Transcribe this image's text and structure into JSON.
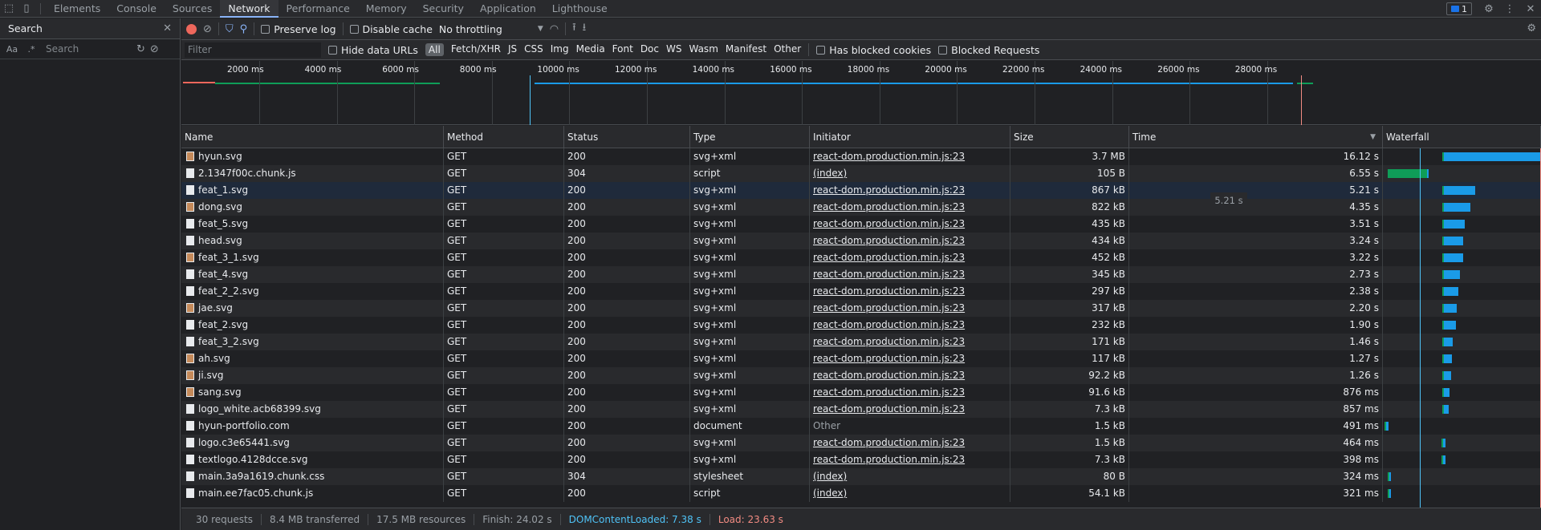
{
  "topbar": {
    "tabs": [
      "Elements",
      "Console",
      "Sources",
      "Network",
      "Performance",
      "Memory",
      "Security",
      "Application",
      "Lighthouse"
    ],
    "active_tab": "Network",
    "issues_count": "1"
  },
  "search_panel": {
    "title": "Search",
    "case_toggle": "Aa",
    "regex_toggle": ".*",
    "placeholder": "Search"
  },
  "toolbar": {
    "preserve_log": "Preserve log",
    "disable_cache": "Disable cache",
    "throttling": "No throttling"
  },
  "filter_bar": {
    "placeholder": "Filter",
    "hide_data_urls": "Hide data URLs",
    "types": [
      "All",
      "Fetch/XHR",
      "JS",
      "CSS",
      "Img",
      "Media",
      "Font",
      "Doc",
      "WS",
      "Wasm",
      "Manifest",
      "Other"
    ],
    "has_blocked_cookies": "Has blocked cookies",
    "blocked_requests": "Blocked Requests"
  },
  "overview": {
    "ticks": [
      "2000 ms",
      "4000 ms",
      "6000 ms",
      "8000 ms",
      "10000 ms",
      "12000 ms",
      "14000 ms",
      "16000 ms",
      "18000 ms",
      "20000 ms",
      "22000 ms",
      "24000 ms",
      "26000 ms",
      "28000 ms"
    ]
  },
  "columns": [
    "Name",
    "Method",
    "Status",
    "Type",
    "Initiator",
    "Size",
    "Time",
    "Waterfall"
  ],
  "rows": [
    {
      "name": "hyun.svg",
      "method": "GET",
      "status": "200",
      "type": "svg+xml",
      "initiator": "react-dom.production.min.js:23",
      "size": "3.7 MB",
      "time": "16.12 s",
      "icon": "img",
      "wf_start": 0.376,
      "wf_wait": 0.01,
      "wf_dl": 0.626
    },
    {
      "name": "2.1347f00c.chunk.js",
      "method": "GET",
      "status": "304",
      "type": "script",
      "initiator": "(index)",
      "size": "105 B",
      "time": "6.55 s",
      "icon": "doc",
      "wf_start": 0.03,
      "wf_wait": 0.25,
      "wf_dl": 0.01
    },
    {
      "name": "feat_1.svg",
      "method": "GET",
      "status": "200",
      "type": "svg+xml",
      "initiator": "react-dom.production.min.js:23",
      "size": "867 kB",
      "time": "5.21 s",
      "icon": "doc",
      "wf_start": 0.376,
      "wf_wait": 0.01,
      "wf_dl": 0.2
    },
    {
      "name": "dong.svg",
      "method": "GET",
      "status": "200",
      "type": "svg+xml",
      "initiator": "react-dom.production.min.js:23",
      "size": "822 kB",
      "time": "4.35 s",
      "icon": "img",
      "wf_start": 0.376,
      "wf_wait": 0.01,
      "wf_dl": 0.165
    },
    {
      "name": "feat_5.svg",
      "method": "GET",
      "status": "200",
      "type": "svg+xml",
      "initiator": "react-dom.production.min.js:23",
      "size": "435 kB",
      "time": "3.51 s",
      "icon": "doc",
      "wf_start": 0.376,
      "wf_wait": 0.01,
      "wf_dl": 0.13
    },
    {
      "name": "head.svg",
      "method": "GET",
      "status": "200",
      "type": "svg+xml",
      "initiator": "react-dom.production.min.js:23",
      "size": "434 kB",
      "time": "3.24 s",
      "icon": "doc",
      "wf_start": 0.376,
      "wf_wait": 0.01,
      "wf_dl": 0.12
    },
    {
      "name": "feat_3_1.svg",
      "method": "GET",
      "status": "200",
      "type": "svg+xml",
      "initiator": "react-dom.production.min.js:23",
      "size": "452 kB",
      "time": "3.22 s",
      "icon": "img",
      "wf_start": 0.376,
      "wf_wait": 0.01,
      "wf_dl": 0.12
    },
    {
      "name": "feat_4.svg",
      "method": "GET",
      "status": "200",
      "type": "svg+xml",
      "initiator": "react-dom.production.min.js:23",
      "size": "345 kB",
      "time": "2.73 s",
      "icon": "doc",
      "wf_start": 0.376,
      "wf_wait": 0.01,
      "wf_dl": 0.1
    },
    {
      "name": "feat_2_2.svg",
      "method": "GET",
      "status": "200",
      "type": "svg+xml",
      "initiator": "react-dom.production.min.js:23",
      "size": "297 kB",
      "time": "2.38 s",
      "icon": "doc",
      "wf_start": 0.376,
      "wf_wait": 0.01,
      "wf_dl": 0.09
    },
    {
      "name": "jae.svg",
      "method": "GET",
      "status": "200",
      "type": "svg+xml",
      "initiator": "react-dom.production.min.js:23",
      "size": "317 kB",
      "time": "2.20 s",
      "icon": "img",
      "wf_start": 0.376,
      "wf_wait": 0.01,
      "wf_dl": 0.08
    },
    {
      "name": "feat_2.svg",
      "method": "GET",
      "status": "200",
      "type": "svg+xml",
      "initiator": "react-dom.production.min.js:23",
      "size": "232 kB",
      "time": "1.90 s",
      "icon": "doc",
      "wf_start": 0.376,
      "wf_wait": 0.01,
      "wf_dl": 0.075
    },
    {
      "name": "feat_3_2.svg",
      "method": "GET",
      "status": "200",
      "type": "svg+xml",
      "initiator": "react-dom.production.min.js:23",
      "size": "171 kB",
      "time": "1.46 s",
      "icon": "doc",
      "wf_start": 0.376,
      "wf_wait": 0.01,
      "wf_dl": 0.055
    },
    {
      "name": "ah.svg",
      "method": "GET",
      "status": "200",
      "type": "svg+xml",
      "initiator": "react-dom.production.min.js:23",
      "size": "117 kB",
      "time": "1.27 s",
      "icon": "img",
      "wf_start": 0.376,
      "wf_wait": 0.01,
      "wf_dl": 0.048
    },
    {
      "name": "ji.svg",
      "method": "GET",
      "status": "200",
      "type": "svg+xml",
      "initiator": "react-dom.production.min.js:23",
      "size": "92.2 kB",
      "time": "1.26 s",
      "icon": "img",
      "wf_start": 0.376,
      "wf_wait": 0.01,
      "wf_dl": 0.047
    },
    {
      "name": "sang.svg",
      "method": "GET",
      "status": "200",
      "type": "svg+xml",
      "initiator": "react-dom.production.min.js:23",
      "size": "91.6 kB",
      "time": "876 ms",
      "icon": "img",
      "wf_start": 0.376,
      "wf_wait": 0.01,
      "wf_dl": 0.033
    },
    {
      "name": "logo_white.acb68399.svg",
      "method": "GET",
      "status": "200",
      "type": "svg+xml",
      "initiator": "react-dom.production.min.js:23",
      "size": "7.3 kB",
      "time": "857 ms",
      "icon": "doc",
      "wf_start": 0.376,
      "wf_wait": 0.01,
      "wf_dl": 0.032
    },
    {
      "name": "hyun-portfolio.com",
      "method": "GET",
      "status": "200",
      "type": "document",
      "initiator": "Other",
      "size": "1.5 kB",
      "time": "491 ms",
      "icon": "doc",
      "wf_start": 0.012,
      "wf_wait": 0.005,
      "wf_dl": 0.014
    },
    {
      "name": "logo.c3e65441.svg",
      "method": "GET",
      "status": "200",
      "type": "svg+xml",
      "initiator": "react-dom.production.min.js:23",
      "size": "1.5 kB",
      "time": "464 ms",
      "icon": "doc",
      "wf_start": 0.37,
      "wf_wait": 0.005,
      "wf_dl": 0.016
    },
    {
      "name": "textlogo.4128dcce.svg",
      "method": "GET",
      "status": "200",
      "type": "svg+xml",
      "initiator": "react-dom.production.min.js:23",
      "size": "7.3 kB",
      "time": "398 ms",
      "icon": "doc",
      "wf_start": 0.37,
      "wf_wait": 0.005,
      "wf_dl": 0.014
    },
    {
      "name": "main.3a9a1619.chunk.css",
      "method": "GET",
      "status": "304",
      "type": "stylesheet",
      "initiator": "(index)",
      "size": "80 B",
      "time": "324 ms",
      "icon": "doc",
      "wf_start": 0.03,
      "wf_wait": 0.005,
      "wf_dl": 0.012
    },
    {
      "name": "main.ee7fac05.chunk.js",
      "method": "GET",
      "status": "200",
      "type": "script",
      "initiator": "(index)",
      "size": "54.1 kB",
      "time": "321 ms",
      "icon": "doc",
      "wf_start": 0.03,
      "wf_wait": 0.005,
      "wf_dl": 0.012
    }
  ],
  "tooltip": "5.21 s",
  "statusbar": {
    "requests": "30 requests",
    "transferred": "8.4 MB transferred",
    "resources": "17.5 MB resources",
    "finish": "Finish: 24.02 s",
    "dcl": "DOMContentLoaded: 7.38 s",
    "load": "Load: 23.63 s"
  },
  "colors": {
    "waiting": "#0f9d58",
    "download": "#1a9be8",
    "dcl_line": "#4fc3f7",
    "load_line": "#f28b82"
  }
}
